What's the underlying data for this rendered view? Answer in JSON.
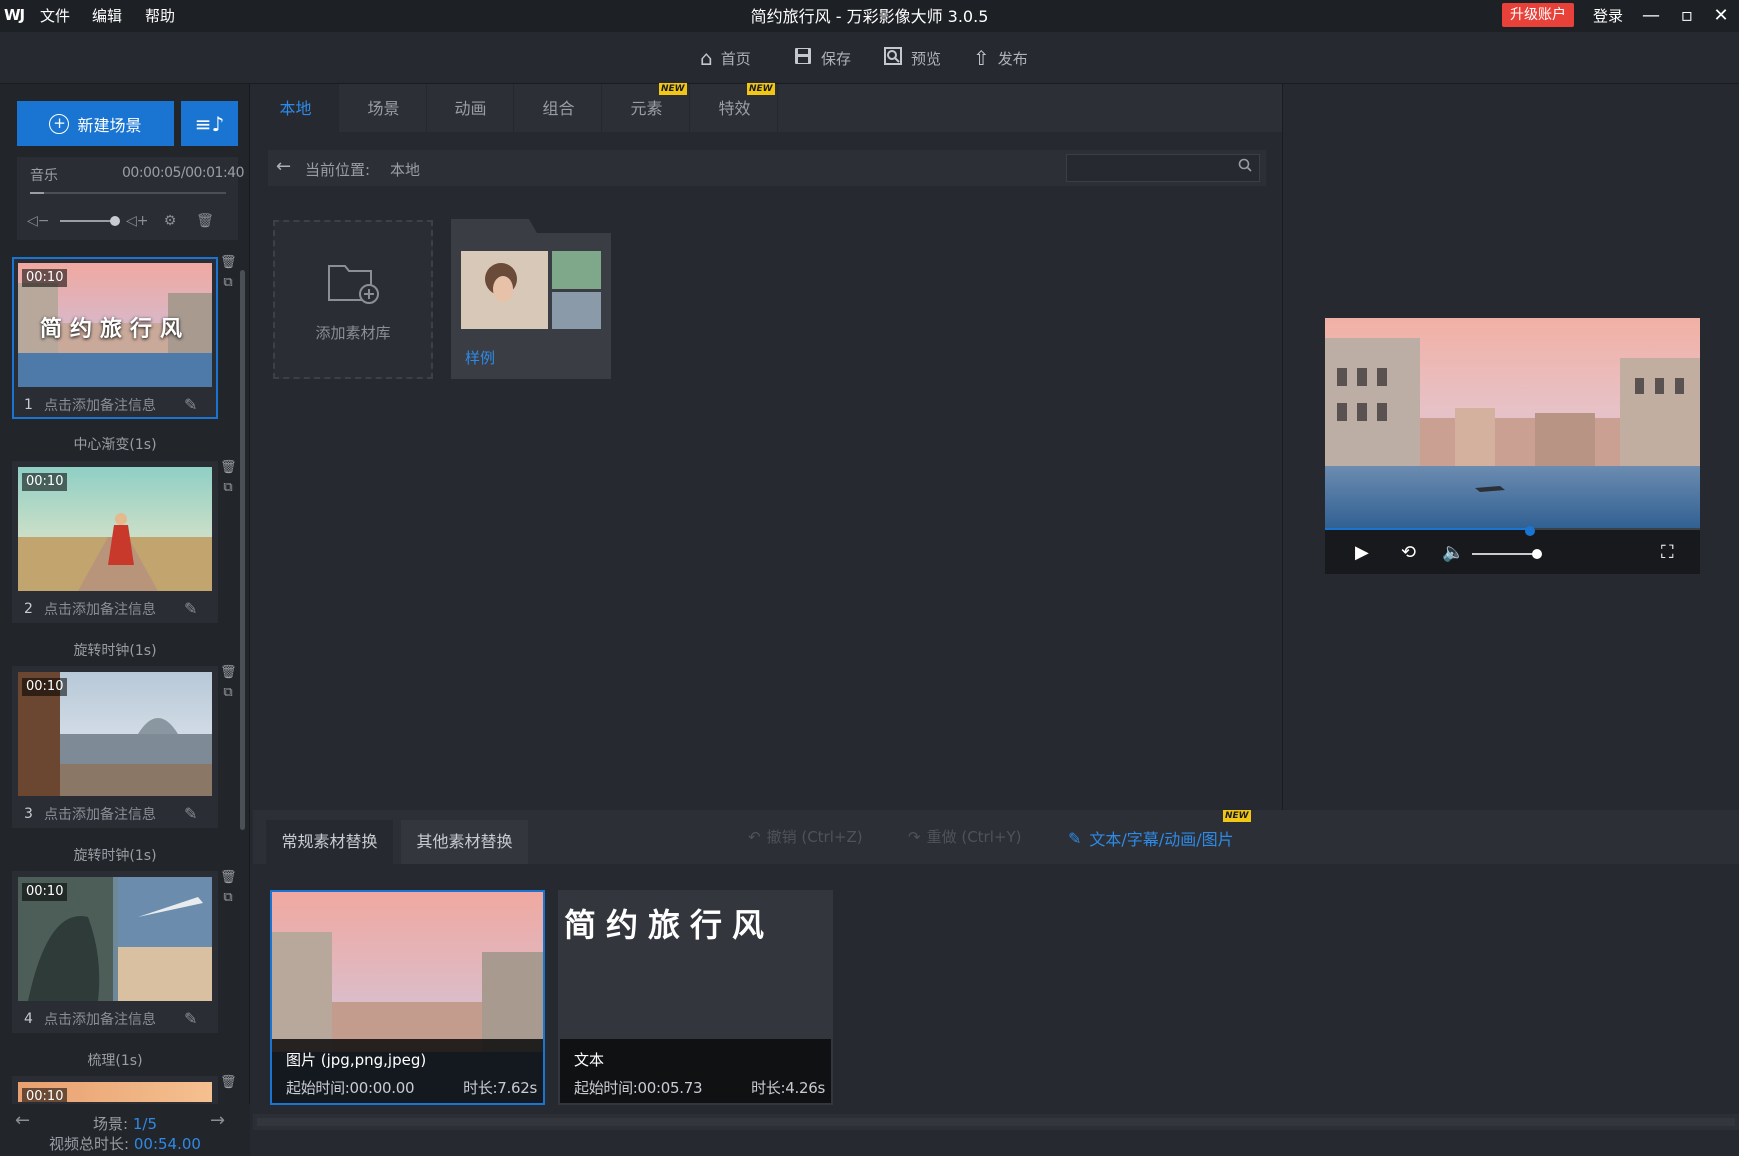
{
  "app": {
    "logo": "WJ",
    "menu": [
      "文件",
      "编辑",
      "帮助"
    ],
    "title": "简约旅行风 - 万彩影像大师 3.0.5",
    "upgrade": "升级账户",
    "login": "登录"
  },
  "toolbar": {
    "home": "首页",
    "save": "保存",
    "preview": "预览",
    "publish": "发布"
  },
  "left": {
    "new_scene": "新建场景",
    "music_label": "音乐",
    "music_time": "00:00:05/00:01:40",
    "scenes": [
      {
        "time": "00:10",
        "index": "1",
        "note": "点击添加备注信息",
        "overlay": "简约旅行风"
      },
      {
        "time": "00:10",
        "index": "2",
        "note": "点击添加备注信息"
      },
      {
        "time": "00:10",
        "index": "3",
        "note": "点击添加备注信息"
      },
      {
        "time": "00:10",
        "index": "4",
        "note": "点击添加备注信息"
      },
      {
        "time": "00:10"
      }
    ],
    "transitions": [
      "中心渐变(1s)",
      "旋转时钟(1s)",
      "旋转时钟(1s)",
      "梳理(1s)"
    ],
    "scene_count_label": "场景: ",
    "scene_count_value": "1/5",
    "total_label": "视频总时长: ",
    "total_value": "00:54.00"
  },
  "materials": {
    "tabs": [
      "本地",
      "场景",
      "动画",
      "组合",
      "元素",
      "特效"
    ],
    "new_badge": "NEW",
    "crumb_label": "当前位置:",
    "crumb_path": "本地",
    "search_placeholder": "",
    "add_library": "添加素材库",
    "sample_folder": "样例"
  },
  "edit": {
    "tab_regular": "常规素材替换",
    "tab_other": "其他素材替换",
    "undo": "撤销 (Ctrl+Z)",
    "redo": "重做 (Ctrl+Y)",
    "text_anim": "文本/字幕/动画/图片",
    "new_badge": "NEW",
    "clips": [
      {
        "type": "图片 (jpg,png,jpeg)",
        "start": "起始时间:00:00.00",
        "duration": "时长:7.62s"
      },
      {
        "type": "文本",
        "start": "起始时间:00:05.73",
        "duration": "时长:4.26s",
        "text": "简约旅行风"
      }
    ]
  },
  "colors": {
    "accent": "#1a75d2",
    "upgrade": "#e8413a",
    "badge": "#f2c615"
  }
}
